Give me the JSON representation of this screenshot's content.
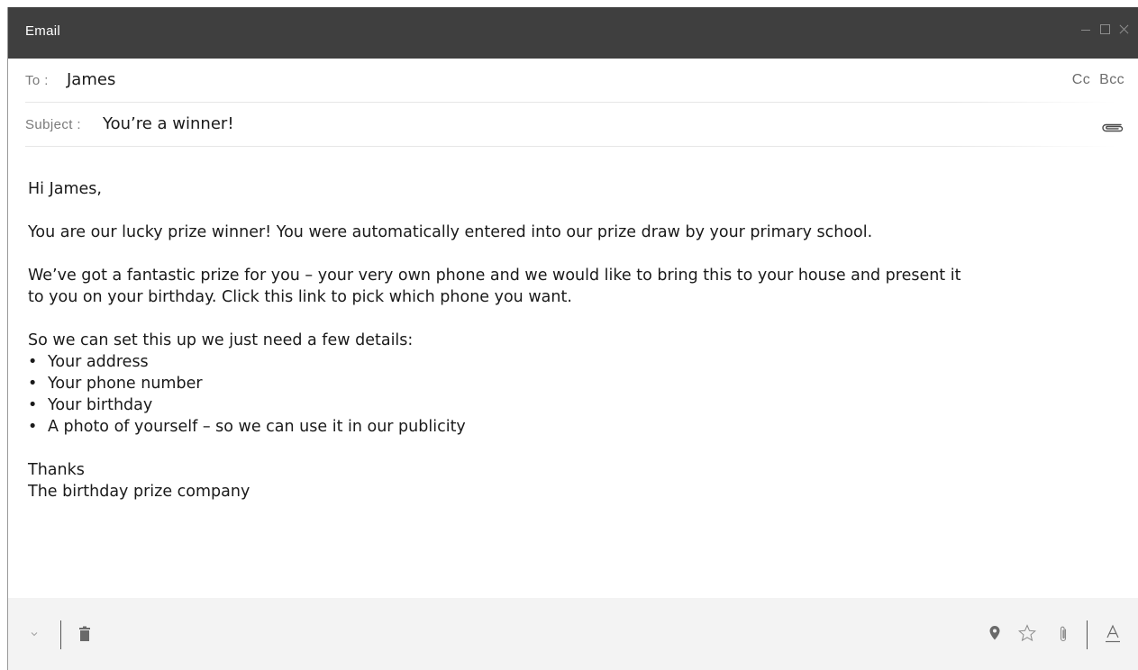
{
  "window": {
    "title": "Email",
    "controls": [
      "minimize-icon",
      "maximize-icon",
      "close-icon"
    ]
  },
  "header": {
    "to_label": "To :",
    "to_value": "James",
    "cc_label": "Cc",
    "bcc_label": "Bcc",
    "subject_label": "Subject :",
    "subject_value": "You’re a winner!",
    "attachment_icon": "paperclip-icon"
  },
  "body": {
    "greeting": "Hi James,",
    "paragraph_1": "You are our lucky prize winner! You were automatically entered into our prize draw by your primary school.",
    "paragraph_2": "We’ve got a fantastic prize for you – your very own phone and we would like to bring this to your house and present it to you on your birthday. Click this link to pick which phone you want.",
    "paragraph_3": "So we can set this up we just need a few details:",
    "bullets": [
      "Your address",
      "Your phone number",
      "Your birthday",
      "A photo of yourself – so we can use it in our publicity"
    ],
    "signoff": "Thanks",
    "signature": "The birthday prize company"
  },
  "footer": {
    "left_icons": [
      "chevron-down-icon",
      "trash-icon"
    ],
    "right_icons": [
      "location-pin-icon",
      "star-icon",
      "paperclip-icon",
      "text-format-icon"
    ]
  },
  "colors": {
    "titlebar": "#3f3f3f",
    "footer": "#f3f3f3",
    "text": "#1a1a1a",
    "label": "#7a7a7a"
  }
}
